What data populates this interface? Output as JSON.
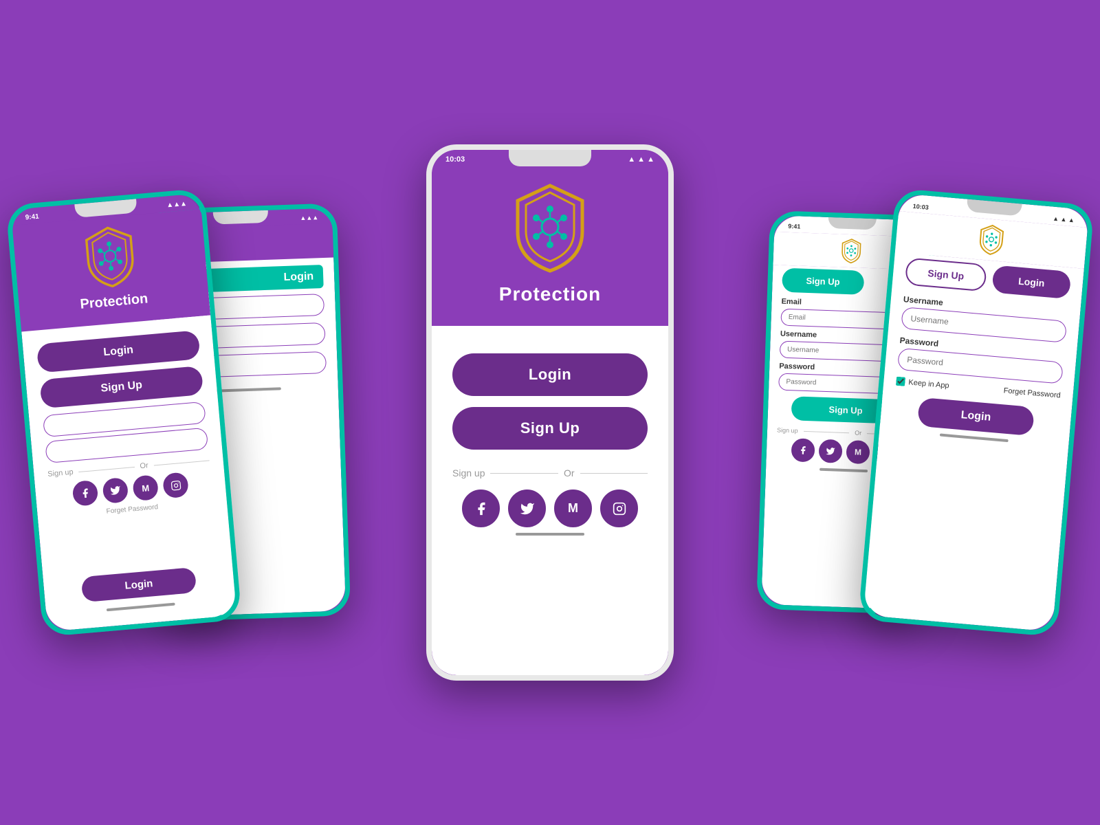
{
  "app": {
    "title": "Protection",
    "background_color": "#8B3DB8",
    "accent_color": "#00BFA5",
    "primary_color": "#6B2D8B"
  },
  "center_phone": {
    "status_time": "10:03",
    "header_title": "Protection",
    "login_btn": "Login",
    "signup_btn": "Sign Up",
    "or_text": "Or",
    "signup_prefix": "Sign up"
  },
  "left_phone": {
    "status_time": "9:41",
    "header_title": "Protection",
    "login_btn": "Login",
    "signup_btn": "Sign Up",
    "or_text": "Or",
    "signup_prefix": "Sign up",
    "forget_password": "Forget Password"
  },
  "back_left_phone": {
    "login_tab": "Login",
    "teal_login": "Login"
  },
  "right_phone": {
    "status_time": "10:03",
    "signup_tab": "Sign Up",
    "login_tab": "Login",
    "username_label": "Username",
    "username_placeholder": "Username",
    "password_label": "Password",
    "password_placeholder": "Password",
    "keep_in_app": "Keep in App",
    "forget_password": "Forget Password",
    "login_btn": "Login"
  },
  "back_right_phone": {
    "status_time": "9:41",
    "signup_btn": "Sign Up",
    "email_label": "Email",
    "email_placeholder": "Email",
    "username_label": "Username",
    "username_placeholder": "Username",
    "password_label": "Password",
    "password_placeholder": "Password",
    "or_text": "Or",
    "signup_prefix": "Sign up",
    "final_signup_btn": "Sign Up"
  },
  "social": {
    "facebook": "f",
    "twitter": "t",
    "gmail": "M",
    "instagram": "ig"
  }
}
